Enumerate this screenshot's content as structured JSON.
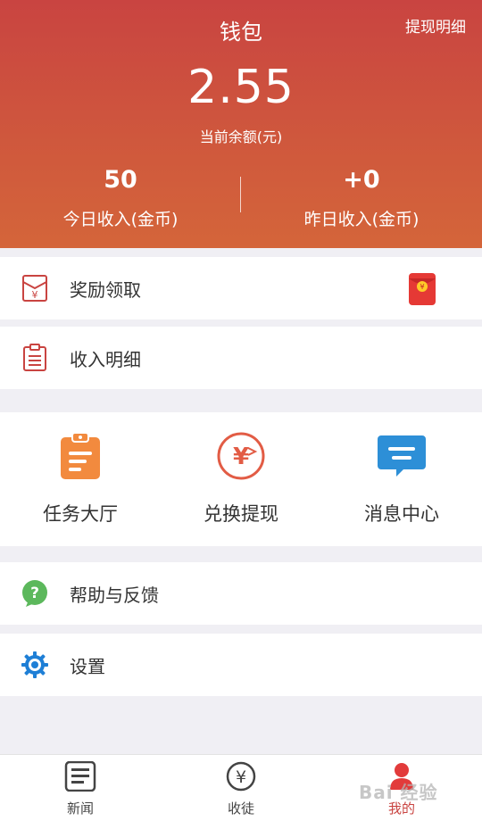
{
  "header": {
    "title": "钱包",
    "withdraw_detail": "提现明细",
    "balance": "2.55",
    "balance_label": "当前余额(元)",
    "today": {
      "value": "50",
      "label": "今日收入(金币)"
    },
    "yesterday": {
      "value": "+0",
      "label": "昨日收入(金币)"
    }
  },
  "rows": {
    "reward": "奖励领取",
    "income": "收入明细",
    "help": "帮助与反馈",
    "settings": "设置"
  },
  "grid": {
    "task": "任务大厅",
    "exchange": "兑换提现",
    "message": "消息中心"
  },
  "tabs": {
    "news": "新闻",
    "apprentice": "收徒",
    "mine": "我的"
  },
  "watermark": "Bai 经验",
  "colors": {
    "header_top": "#c94441",
    "header_bottom": "#d4653a",
    "task_icon": "#f28a3e",
    "exchange_icon": "#e25c45",
    "message_icon": "#2d8fd7",
    "help_icon": "#5cb85c",
    "settings_icon": "#1e7fd6"
  }
}
